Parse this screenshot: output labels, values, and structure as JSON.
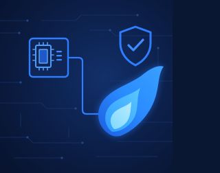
{
  "illustration": {
    "background_color": "#0a1733",
    "accent_color": "#2f7dff",
    "highlight_color": "#5cc8ff",
    "icons": [
      "microchip-icon",
      "shield-check-icon",
      "flame-icon"
    ]
  }
}
